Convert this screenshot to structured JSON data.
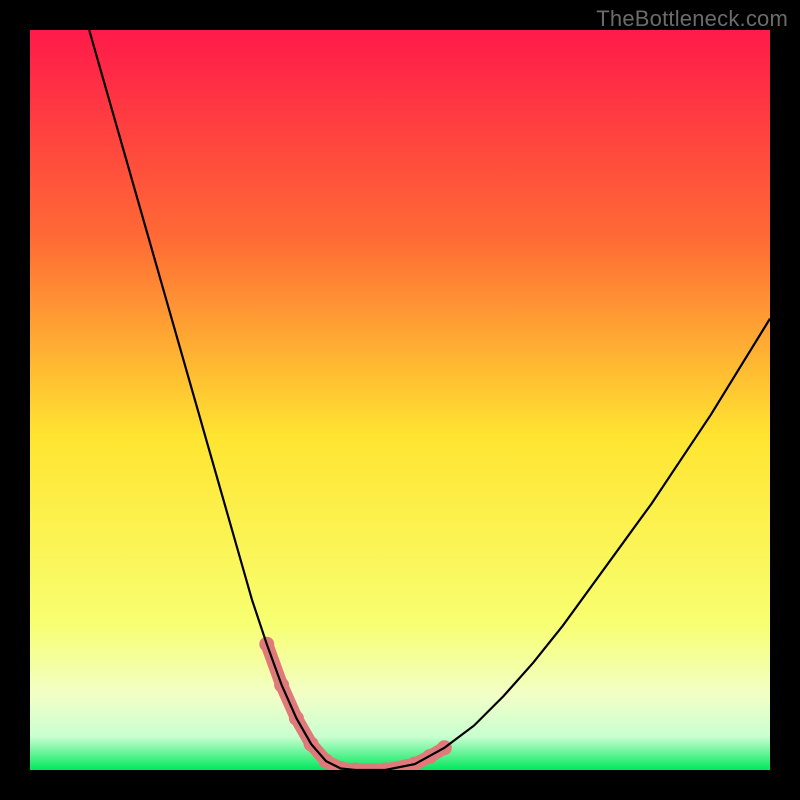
{
  "attribution": "TheBottleneck.com",
  "colors": {
    "frame": "#000000",
    "gradient_top": "#ff1a4a",
    "gradient_mid_upper": "#ff8a2a",
    "gradient_mid": "#ffe531",
    "gradient_low": "#f6ff8a",
    "gradient_band_pale": "#eaffea",
    "gradient_bottom": "#00e85d",
    "curve": "#000000",
    "highlight": "#e07a7a"
  },
  "chart_data": {
    "type": "line",
    "title": "",
    "xlabel": "",
    "ylabel": "",
    "xlim": [
      0,
      100
    ],
    "ylim": [
      0,
      100
    ],
    "grid": false,
    "legend": false,
    "series": [
      {
        "name": "bottleneck-curve",
        "x": [
          8,
          10,
          12,
          14,
          16,
          18,
          20,
          22,
          24,
          26,
          28,
          30,
          32,
          34,
          36,
          38,
          40,
          42,
          44,
          48,
          52,
          56,
          60,
          64,
          68,
          72,
          76,
          80,
          84,
          88,
          92,
          96,
          100
        ],
        "values": [
          100,
          93,
          86,
          79,
          72,
          65,
          58,
          51,
          44,
          37,
          30,
          23,
          17,
          11.5,
          7,
          3.5,
          1.2,
          0.2,
          0,
          0,
          0.8,
          3,
          6,
          10,
          14.5,
          19.5,
          25,
          30.5,
          36,
          42,
          48,
          54.5,
          61
        ]
      }
    ],
    "highlight_segments": [
      {
        "x": [
          32,
          34,
          36,
          38,
          40
        ],
        "values": [
          17,
          11.5,
          7,
          3.5,
          1.2
        ]
      },
      {
        "x": [
          40,
          42,
          44,
          48,
          52
        ],
        "values": [
          1.2,
          0.2,
          0,
          0,
          0.8
        ]
      },
      {
        "x": [
          52,
          54,
          56
        ],
        "values": [
          0.8,
          1.8,
          3
        ]
      }
    ],
    "background_gradient_stops": [
      {
        "offset": 0.0,
        "color": "#ff1a4a"
      },
      {
        "offset": 0.28,
        "color": "#ff6a35"
      },
      {
        "offset": 0.55,
        "color": "#ffe531"
      },
      {
        "offset": 0.8,
        "color": "#f8ff70"
      },
      {
        "offset": 0.9,
        "color": "#f1ffc8"
      },
      {
        "offset": 0.955,
        "color": "#c9ffd0"
      },
      {
        "offset": 1.0,
        "color": "#00e85d"
      }
    ]
  }
}
